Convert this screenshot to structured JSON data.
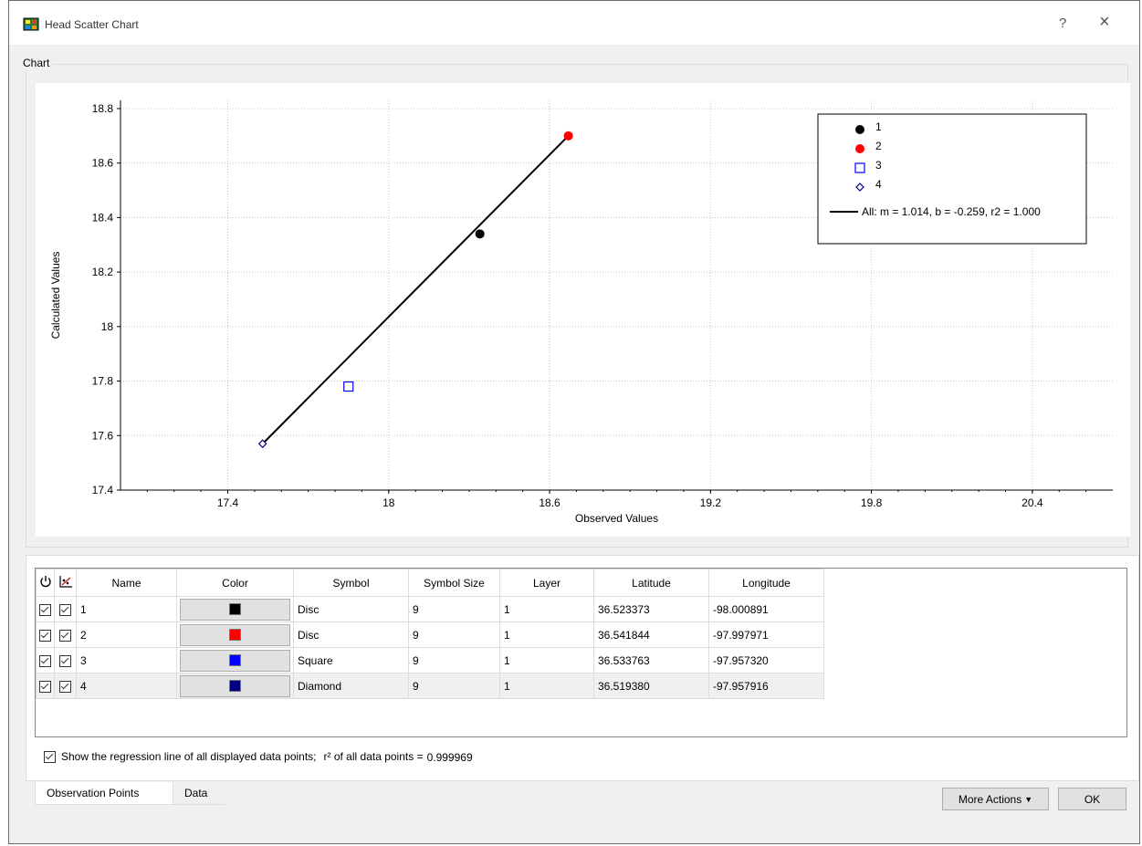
{
  "window": {
    "title": "Head Scatter Chart",
    "help_label": "?",
    "close_label": "×"
  },
  "chart_group": {
    "label": "Chart"
  },
  "chart_data": {
    "type": "scatter",
    "xlabel": "Observed Values",
    "ylabel": "Calculated Values",
    "xlim": [
      17,
      20.7
    ],
    "ylim": [
      17.4,
      18.83
    ],
    "xticks": [
      17.4,
      18,
      18.6,
      19.2,
      19.8,
      20.4
    ],
    "xtick_labels": [
      "17.4",
      "18",
      "18.6",
      "19.2",
      "19.8",
      "20.4"
    ],
    "yticks": [
      17.4,
      17.6,
      17.8,
      18,
      18.2,
      18.4,
      18.6,
      18.8
    ],
    "ytick_labels": [
      "17.4",
      "17.6",
      "17.8",
      "18",
      "18.2",
      "18.4",
      "18.6",
      "18.8"
    ],
    "grid": true,
    "legend_placement": "top-right",
    "series": [
      {
        "name": "1",
        "marker": "disc",
        "color": "#000000",
        "x": 18.34,
        "y": 18.34
      },
      {
        "name": "2",
        "marker": "disc",
        "color": "#ff0000",
        "x": 18.67,
        "y": 18.7
      },
      {
        "name": "3",
        "marker": "square",
        "color": "#0000ff",
        "x": 17.85,
        "y": 17.78
      },
      {
        "name": "4",
        "marker": "diamond",
        "color": "#000080",
        "x": 17.53,
        "y": 17.57
      }
    ],
    "regression": {
      "label": "All: m = 1.014, b = -0.259, r2 = 1.000",
      "color": "#000000",
      "x": [
        17.53,
        18.67
      ],
      "y": [
        17.57,
        18.7
      ]
    }
  },
  "table": {
    "headers": [
      "Name",
      "Color",
      "Symbol",
      "Symbol Size",
      "Layer",
      "Latitude",
      "Longitude"
    ],
    "rows": [
      {
        "name": "1",
        "color": "#000000",
        "symbol": "Disc",
        "size": "9",
        "layer": "1",
        "lat": "36.523373",
        "lon": "-98.000891"
      },
      {
        "name": "2",
        "color": "#ff0000",
        "symbol": "Disc",
        "size": "9",
        "layer": "1",
        "lat": "36.541844",
        "lon": "-97.997971"
      },
      {
        "name": "3",
        "color": "#0000ff",
        "symbol": "Square",
        "size": "9",
        "layer": "1",
        "lat": "36.533763",
        "lon": "-97.957320"
      },
      {
        "name": "4",
        "color": "#000080",
        "symbol": "Diamond",
        "size": "9",
        "layer": "1",
        "lat": "36.519380",
        "lon": "-97.957916"
      }
    ]
  },
  "regression_option": {
    "label": "Show the regression line of all displayed data points;",
    "r2_label": "r² of all data points =",
    "r2_value": "0.999969"
  },
  "tabs": [
    "Observation Points",
    "Data"
  ],
  "buttons": {
    "more_actions": "More Actions",
    "ok": "OK"
  }
}
